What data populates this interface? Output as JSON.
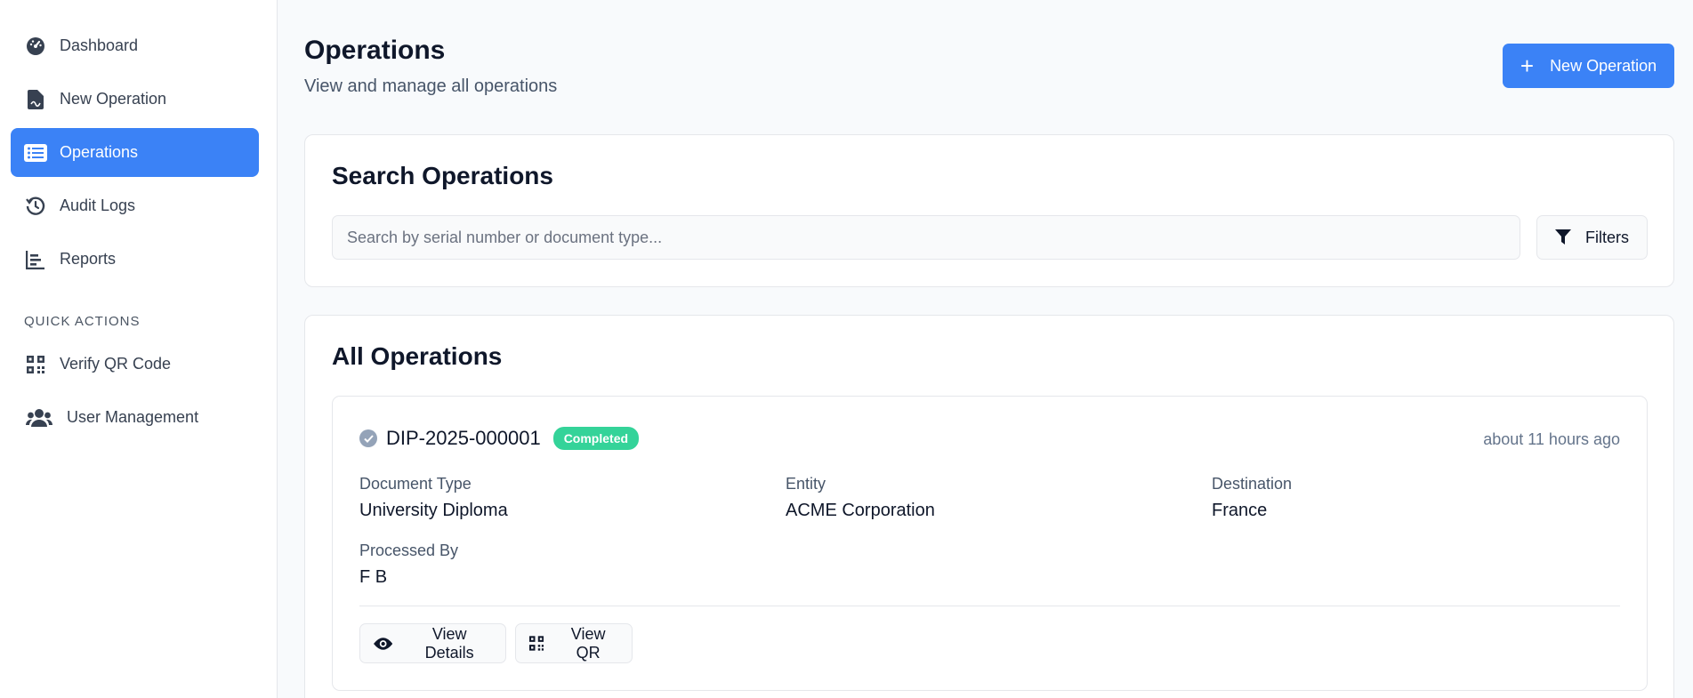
{
  "sidebar": {
    "items": [
      {
        "label": "Dashboard",
        "icon": "dashboard-gauge-icon"
      },
      {
        "label": "New Operation",
        "icon": "file-signature-icon"
      },
      {
        "label": "Operations",
        "icon": "list-icon",
        "active": true
      },
      {
        "label": "Audit Logs",
        "icon": "history-icon"
      },
      {
        "label": "Reports",
        "icon": "bar-chart-icon"
      }
    ],
    "quick_actions_label": "QUICK ACTIONS",
    "quick_actions": [
      {
        "label": "Verify QR Code",
        "icon": "qrcode-icon"
      },
      {
        "label": "User Management",
        "icon": "users-icon"
      }
    ]
  },
  "header": {
    "title": "Operations",
    "subtitle": "View and manage all operations",
    "new_button": "New Operation"
  },
  "search": {
    "title": "Search Operations",
    "placeholder": "Search by serial number or document type...",
    "filters_label": "Filters"
  },
  "operations": {
    "title": "All Operations",
    "items": [
      {
        "serial": "DIP-2025-000001",
        "status": "Completed",
        "time": "about 11 hours ago",
        "document_type_label": "Document Type",
        "document_type": "University Diploma",
        "entity_label": "Entity",
        "entity": "ACME Corporation",
        "destination_label": "Destination",
        "destination": "France",
        "processed_by_label": "Processed By",
        "processed_by": "F B",
        "view_details_label": "View Details",
        "view_qr_label": "View QR"
      }
    ]
  },
  "colors": {
    "accent": "#3b82f6",
    "status_completed": "#34d399"
  }
}
